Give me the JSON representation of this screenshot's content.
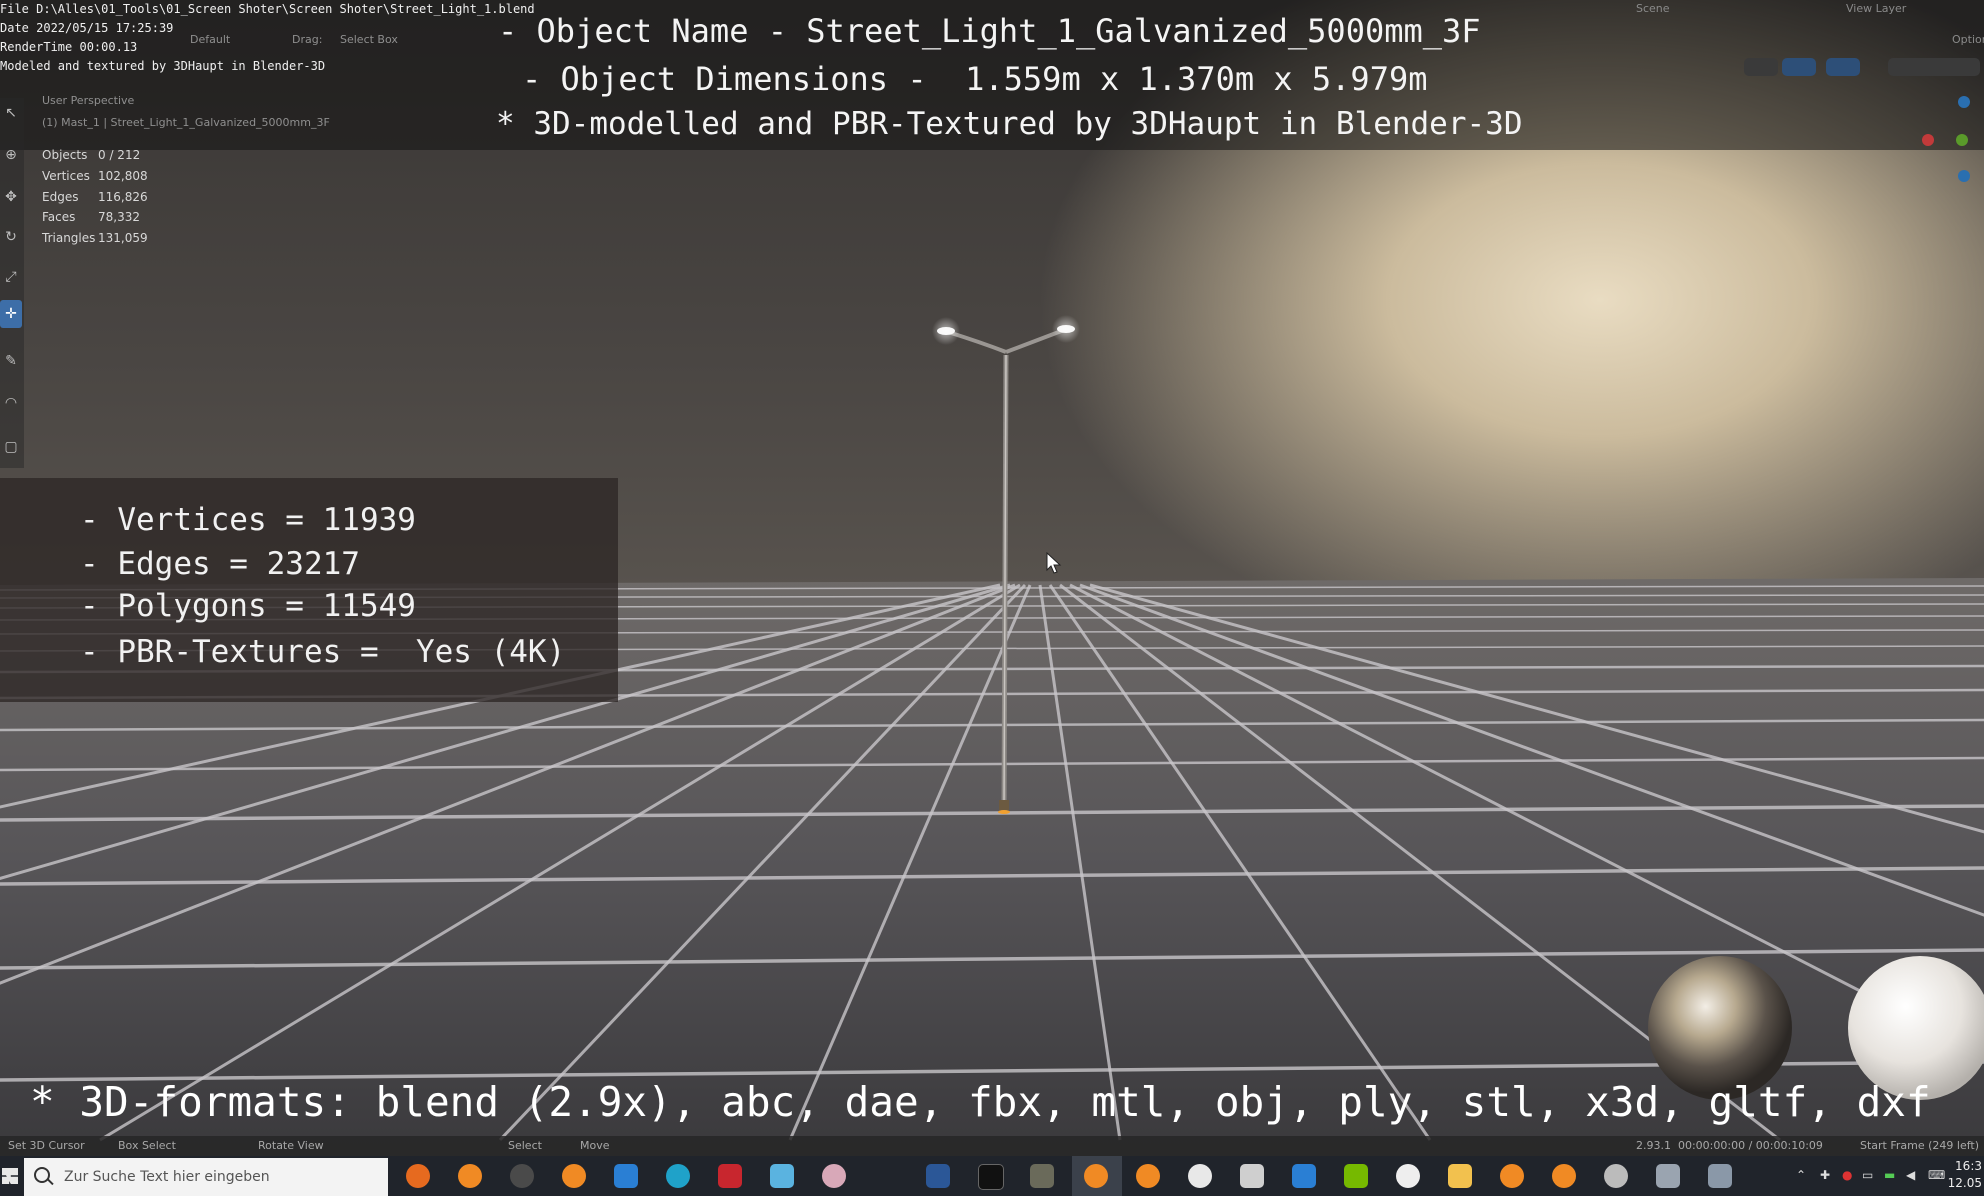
{
  "render_info": {
    "file": "File D:\\Alles\\01_Tools\\01_Screen Shoter\\Screen Shoter\\Street_Light_1.blend",
    "date": "Date 2022/05/15 17:25:39",
    "render_time": "RenderTime 00:00.13",
    "credit": "Modeled and textured by 3DHaupt in Blender-3D"
  },
  "header_overlay": {
    "line1": "- Object Name - Street_Light_1_Galvanized_5000mm_3F",
    "line2": "- Object Dimensions -  1.559m x 1.370m x 5.979m",
    "line3": "* 3D-modelled and PBR-Textured by 3DHaupt in Blender-3D"
  },
  "blender_header": {
    "orientation": "Default",
    "drag_label": "Drag:",
    "drag_value": "Select Box",
    "scene": "Scene",
    "view_layer": "View Layer",
    "options": "Options"
  },
  "viewport_info": {
    "perspective": "User Perspective",
    "object_path": "(1) Mast_1 | Street_Light_1_Galvanized_5000mm_3F",
    "stats": [
      {
        "label": "Objects",
        "value": "0 / 212"
      },
      {
        "label": "Vertices",
        "value": "102,808"
      },
      {
        "label": "Edges",
        "value": "116,826"
      },
      {
        "label": "Faces",
        "value": "78,332"
      },
      {
        "label": "Triangles",
        "value": "131,059"
      }
    ]
  },
  "mesh_stats": [
    "- Vertices = 11939",
    "- Edges = 23217",
    "- Polygons = 11549",
    "- PBR-Textures =  Yes (4K)"
  ],
  "formats_line": "* 3D-formats: blend (2.9x), abc, dae, fbx, mtl, obj, ply, stl, x3d, gltf, dxf",
  "status_bar": {
    "set_cursor": "Set 3D Cursor",
    "box_select": "Box Select",
    "rotate_view": "Rotate View",
    "select": "Select",
    "move": "Move",
    "version_time": "2.93.1  00:00:00:00 / 00:00:10:09",
    "start_frame": "Start Frame (249 left)"
  },
  "taskbar": {
    "search_placeholder": "Zur Suche Text hier eingeben",
    "clock_time": "16:3",
    "clock_date": "12.05"
  },
  "colors": {
    "active_tool": "#3d6ea8",
    "taskbar": "#20242b",
    "gizmo_x": "#c23a3a",
    "gizmo_y": "#5a9a2a",
    "gizmo_z": "#2a6fb0"
  },
  "icons": {
    "taskbar_apps": [
      "firefox-icon",
      "blender-icon",
      "obs-icon",
      "blender-icon",
      "mail-icon",
      "edge-icon",
      "app-icon",
      "notes-icon",
      "brain-icon",
      "word-icon",
      "terminal-icon",
      "tool-icon",
      "blender-icon",
      "blender-icon",
      "panda-icon",
      "cube-icon",
      "calendar-icon",
      "nvidia-icon",
      "media-icon",
      "folder-icon",
      "blender-icon",
      "blender-icon",
      "gear-icon",
      "files-icon",
      "display-icon"
    ]
  }
}
